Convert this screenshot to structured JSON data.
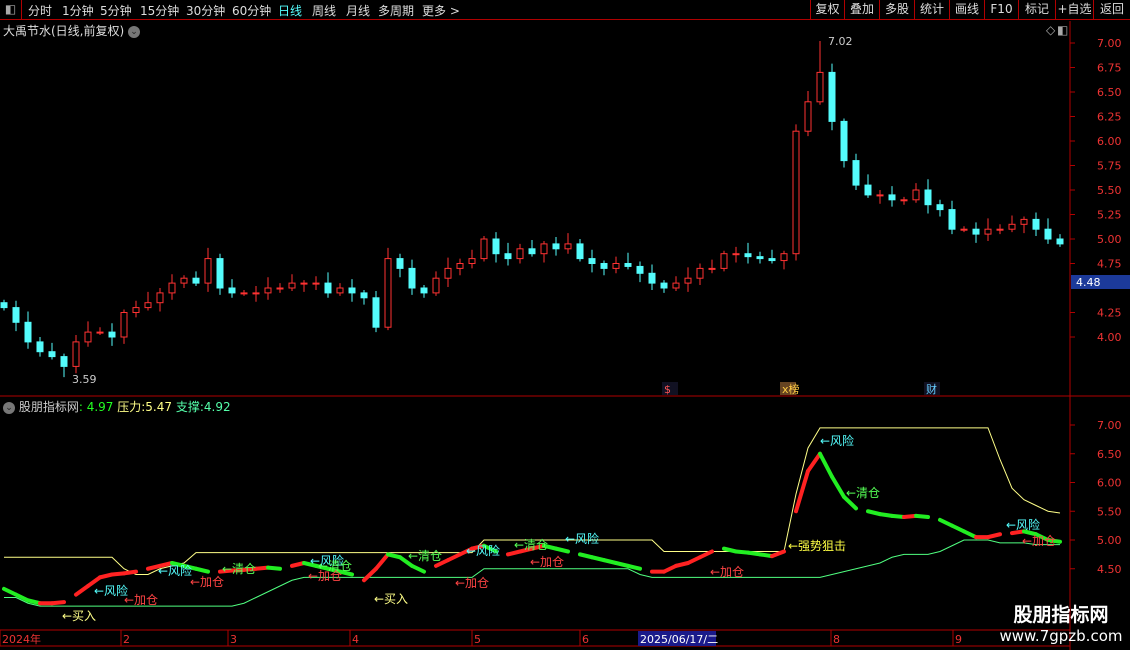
{
  "toolbar": {
    "periods": [
      "分时",
      "1分钟",
      "5分钟",
      "15分钟",
      "30分钟",
      "60分钟",
      "日线",
      "周线",
      "月线",
      "多周期",
      "更多 >"
    ],
    "active": "日线",
    "right": [
      "复权",
      "叠加",
      "多股",
      "统计",
      "画线",
      "F10",
      "标记",
      "+自选",
      "返回"
    ]
  },
  "main": {
    "title": "大禹节水(日线,前复权)",
    "price_ticks": [
      "7.00",
      "6.75",
      "6.50",
      "6.25",
      "6.00",
      "5.75",
      "5.50",
      "5.25",
      "5.00",
      "4.75",
      "4.25",
      "4.00"
    ],
    "current_price": "4.48",
    "high_label": "7.02",
    "low_label": "3.59",
    "markers": [
      "$",
      "x榜",
      "财"
    ]
  },
  "indicator": {
    "name": "股朋指标网",
    "value": ": 4.97",
    "pressure_label": "压力:",
    "pressure": "5.47",
    "support_label": "支撑:",
    "support": "4.92",
    "ticks": [
      "7.00",
      "6.50",
      "6.00",
      "5.50",
      "5.00",
      "4.50"
    ],
    "labels": [
      "←买入",
      "←风险",
      "←加仓",
      "←风险",
      "←加仓",
      "←清仓",
      "←风险",
      "←加仓",
      "←清仓",
      "←买入",
      "←清仓",
      "←风险",
      "←加仓",
      "←清仓",
      "←加仓",
      "←风险",
      "←加仓",
      "←强势狙击",
      "←风险",
      "←清仓",
      "←风险",
      "←加仓"
    ]
  },
  "xaxis": {
    "labels": [
      "2024年",
      "2",
      "3",
      "4",
      "5",
      "6",
      "8",
      "9"
    ],
    "cursor_date": "2025/06/17/二"
  },
  "watermark": {
    "line1": "股朋指标网",
    "line2": "www.7gpzb.com"
  },
  "colors": {
    "up": "#ff3232",
    "down": "#54fcfc",
    "pressure": "#ffff88",
    "support": "#50ff80",
    "grid": "#b00000"
  },
  "chart_data": {
    "type": "candlestick",
    "closes": [
      4.3,
      4.15,
      3.95,
      3.85,
      3.8,
      3.7,
      3.95,
      4.05,
      4.05,
      4.0,
      4.25,
      4.3,
      4.35,
      4.45,
      4.55,
      4.6,
      4.55,
      4.8,
      4.5,
      4.45,
      4.45,
      4.45,
      4.5,
      4.5,
      4.55,
      4.55,
      4.55,
      4.45,
      4.5,
      4.45,
      4.4,
      4.1,
      4.8,
      4.7,
      4.5,
      4.45,
      4.6,
      4.7,
      4.75,
      4.8,
      5.0,
      4.85,
      4.8,
      4.9,
      4.85,
      4.95,
      4.9,
      4.95,
      4.8,
      4.75,
      4.7,
      4.75,
      4.72,
      4.65,
      4.55,
      4.5,
      4.55,
      4.6,
      4.7,
      4.7,
      4.85,
      4.85,
      4.82,
      4.8,
      4.78,
      4.85,
      6.1,
      6.4,
      6.7,
      6.2,
      5.8,
      5.55,
      5.45,
      5.45,
      5.4,
      5.4,
      5.5,
      5.35,
      5.3,
      5.1,
      5.1,
      5.05,
      5.1,
      5.1,
      5.15,
      5.2,
      5.1,
      5.0,
      4.95
    ],
    "ylim": [
      3.4,
      7.1
    ],
    "indicator_main": [
      4.15,
      4.05,
      3.95,
      3.9,
      3.9,
      3.92,
      4.05,
      4.2,
      4.35,
      4.4,
      4.42,
      4.45,
      4.5,
      4.55,
      4.6,
      4.55,
      4.5,
      4.45,
      4.45,
      4.47,
      4.48,
      4.5,
      4.52,
      4.5,
      4.55,
      4.6,
      4.55,
      4.5,
      4.45,
      4.4,
      4.3,
      4.5,
      4.75,
      4.7,
      4.55,
      4.45,
      4.55,
      4.65,
      4.75,
      4.85,
      4.9,
      4.8,
      4.75,
      4.8,
      4.85,
      4.9,
      4.85,
      4.8,
      4.75,
      4.7,
      4.65,
      4.6,
      4.55,
      4.5,
      4.45,
      4.45,
      4.55,
      4.6,
      4.7,
      4.8,
      4.85,
      4.8,
      4.78,
      4.75,
      4.72,
      4.8,
      5.5,
      6.2,
      6.5,
      6.1,
      5.75,
      5.55,
      5.5,
      5.45,
      5.42,
      5.4,
      5.42,
      5.4,
      5.35,
      5.25,
      5.15,
      5.05,
      5.05,
      5.1,
      5.12,
      5.15,
      5.1,
      5.0,
      4.97
    ],
    "pressure": [
      4.7,
      4.7,
      4.7,
      4.7,
      4.7,
      4.7,
      4.7,
      4.7,
      4.7,
      4.7,
      4.5,
      4.4,
      4.4,
      4.5,
      4.55,
      4.6,
      4.78,
      4.78,
      4.78,
      4.78,
      4.78,
      4.78,
      4.78,
      4.78,
      4.78,
      4.78,
      4.78,
      4.78,
      4.78,
      4.78,
      4.78,
      4.78,
      4.78,
      4.78,
      4.78,
      4.78,
      4.78,
      4.78,
      4.78,
      4.78,
      5.0,
      5.0,
      5.0,
      5.0,
      5.0,
      5.0,
      5.0,
      5.0,
      5.0,
      5.0,
      5.0,
      5.0,
      5.0,
      5.0,
      5.0,
      4.8,
      4.8,
      4.8,
      4.8,
      4.8,
      4.8,
      4.8,
      4.8,
      4.8,
      4.8,
      4.8,
      5.8,
      6.6,
      6.95,
      6.95,
      6.95,
      6.95,
      6.95,
      6.95,
      6.95,
      6.95,
      6.95,
      6.95,
      6.95,
      6.95,
      6.95,
      6.95,
      6.95,
      6.4,
      5.9,
      5.7,
      5.6,
      5.5,
      5.47
    ],
    "support": [
      4.0,
      4.0,
      3.9,
      3.85,
      3.85,
      3.85,
      3.85,
      3.85,
      3.85,
      3.85,
      3.85,
      3.85,
      3.85,
      3.85,
      3.85,
      3.85,
      3.85,
      3.85,
      3.85,
      3.85,
      3.9,
      4.0,
      4.1,
      4.2,
      4.3,
      4.35,
      4.35,
      4.35,
      4.35,
      4.35,
      4.35,
      4.35,
      4.35,
      4.35,
      4.35,
      4.35,
      4.35,
      4.35,
      4.35,
      4.35,
      4.5,
      4.5,
      4.5,
      4.5,
      4.5,
      4.5,
      4.5,
      4.5,
      4.5,
      4.5,
      4.5,
      4.5,
      4.5,
      4.4,
      4.35,
      4.35,
      4.35,
      4.35,
      4.35,
      4.35,
      4.35,
      4.35,
      4.35,
      4.35,
      4.35,
      4.35,
      4.35,
      4.35,
      4.35,
      4.4,
      4.45,
      4.5,
      4.55,
      4.6,
      4.7,
      4.75,
      4.75,
      4.75,
      4.8,
      4.9,
      5.0,
      5.0,
      5.0,
      4.95,
      4.95,
      4.95,
      4.92,
      4.92,
      4.92
    ]
  }
}
